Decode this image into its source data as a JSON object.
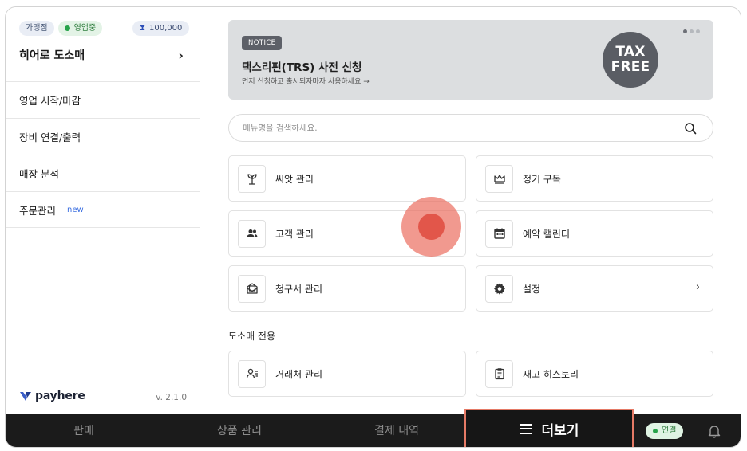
{
  "sidebar": {
    "badges": {
      "branch": "가맹점",
      "status": "영업중",
      "points": "100,000"
    },
    "store_name": "히어로 도소매",
    "items": [
      {
        "label": "영업 시작/마감"
      },
      {
        "label": "장비 연결/출력"
      },
      {
        "label": "매장 분석"
      },
      {
        "label": "주문관리",
        "tag": "new"
      }
    ],
    "brand": "payhere",
    "version": "v. 2.1.0"
  },
  "notice": {
    "tag": "NOTICE",
    "title": "택스리펀(TRS) 사전 신청",
    "subtitle": "먼저 신청하고 출시되자마자 사용하세요 →",
    "badge_line1": "TAX",
    "badge_line2": "FREE"
  },
  "search": {
    "placeholder": "메뉴명을 검색하세요."
  },
  "menu": [
    {
      "label": "씨앗 관리",
      "icon": "sprout-icon"
    },
    {
      "label": "정기 구독",
      "icon": "crown-icon"
    },
    {
      "label": "고객 관리",
      "icon": "people-icon"
    },
    {
      "label": "예약 캘린더",
      "icon": "calendar-icon"
    },
    {
      "label": "청구서 관리",
      "icon": "invoice-icon"
    },
    {
      "label": "설정",
      "icon": "gear-icon"
    }
  ],
  "wholesale": {
    "section_title": "도소매 전용",
    "items": [
      {
        "label": "거래처 관리",
        "icon": "partner-icon"
      },
      {
        "label": "재고 히스토리",
        "icon": "clipboard-icon"
      }
    ]
  },
  "bottom_nav": {
    "tabs": [
      "판매",
      "상품 관리",
      "결제 내역"
    ],
    "more": "더보기",
    "connection": "연결"
  },
  "colors": {
    "highlight": "#e57a66",
    "tap": "#e2564a",
    "status_green": "#27a34a"
  }
}
